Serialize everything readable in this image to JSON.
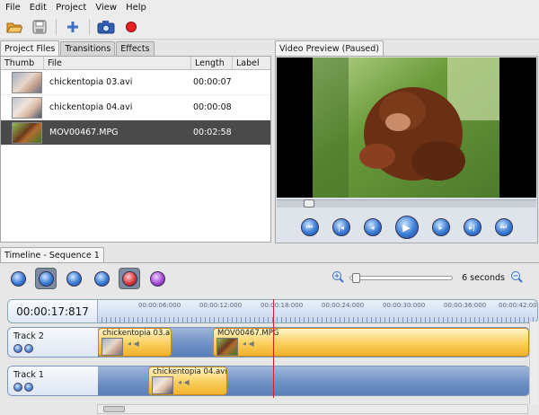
{
  "menu": {
    "items": [
      "File",
      "Edit",
      "Project",
      "View",
      "Help"
    ]
  },
  "toolbar": {
    "icons": [
      "open-folder-icon",
      "save-icon",
      "add-icon",
      "camera-icon",
      "record-icon"
    ]
  },
  "left_tabs": [
    "Project Files",
    "Transitions",
    "Effects"
  ],
  "file_table": {
    "headers": [
      "Thumb",
      "File",
      "Length",
      "Label"
    ],
    "rows": [
      {
        "file": "chickentopia 03.avi",
        "length": "00:00:07",
        "label": ""
      },
      {
        "file": "chickentopia 04.avi",
        "length": "00:00:08",
        "label": ""
      },
      {
        "file": "MOV00467.MPG",
        "length": "00:02:58",
        "label": ""
      }
    ],
    "selected_index": 2
  },
  "preview": {
    "title": "Video Preview (Paused)"
  },
  "timeline": {
    "tab": "Timeline - Sequence 1",
    "timecode": "00:00:17:817",
    "zoom_label": "6 seconds",
    "ticks": [
      "00:00:06:000",
      "00:00:12:000",
      "00:00:18:000",
      "00:00:24:000",
      "00:00:30:000",
      "00:00:36:000",
      "00:00:42:000"
    ],
    "tracks": [
      {
        "name": "Track 2",
        "clips": [
          {
            "name": "chickentopia 03.avi"
          },
          {
            "name": "MOV00467.MPG"
          }
        ]
      },
      {
        "name": "Track 1",
        "clips": [
          {
            "name": "chickentopia 04.avi"
          }
        ]
      }
    ]
  },
  "colors": {
    "accent": "#3a7bd5",
    "clip": "#f9cf5c",
    "playhead": "#d62020",
    "selected_row": "#4a4a4a"
  }
}
